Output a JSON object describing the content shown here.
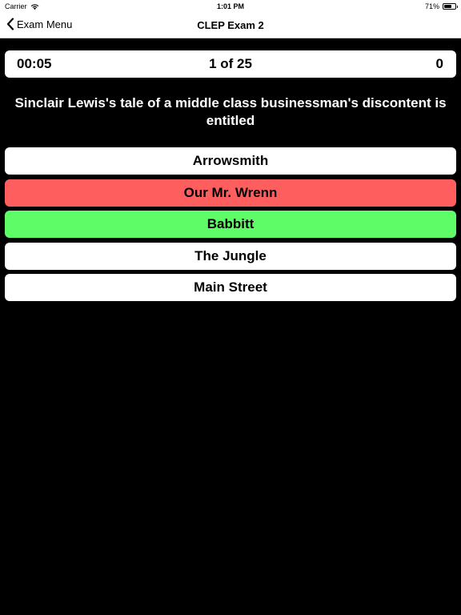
{
  "status_bar": {
    "carrier": "Carrier",
    "time": "1:01 PM",
    "battery_text": "71%",
    "battery_level": 0.71,
    "wifi_icon": "wifi-icon"
  },
  "nav": {
    "back_label": "Exam Menu",
    "title": "CLEP Exam 2"
  },
  "quiz": {
    "timer": "00:05",
    "progress": "1 of 25",
    "score": "0",
    "question": "Sinclair Lewis's tale of a middle class businessman's discontent is entitled"
  },
  "answers": [
    {
      "label": "Arrowsmith",
      "state": "neutral",
      "color": "#ffffff"
    },
    {
      "label": "Our Mr. Wrenn",
      "state": "wrong",
      "color": "#ff5e5e"
    },
    {
      "label": "Babbitt",
      "state": "correct",
      "color": "#5efc66"
    },
    {
      "label": "The Jungle",
      "state": "neutral",
      "color": "#ffffff"
    },
    {
      "label": "Main Street",
      "state": "neutral",
      "color": "#ffffff"
    }
  ],
  "colors": {
    "background": "#000000",
    "panel": "#ffffff",
    "wrong": "#ff5e5e",
    "correct": "#5efc66"
  }
}
